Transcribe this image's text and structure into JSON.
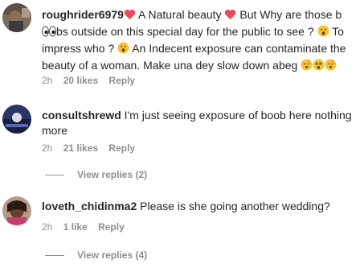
{
  "comments": [
    {
      "username": "roughrider6979",
      "lines": [
        {
          "parts": [
            {
              "t": "emoji",
              "icon": "red-heart-icon"
            },
            {
              "t": "text",
              "v": " A Natural beauty "
            },
            {
              "t": "emoji",
              "icon": "red-heart-icon"
            },
            {
              "t": "text",
              "v": " But Why are those b"
            }
          ]
        },
        {
          "parts": [
            {
              "t": "emoji",
              "icon": "eyes-icon"
            },
            {
              "t": "text",
              "v": "bs outside on this special day for the public to see ? "
            },
            {
              "t": "emoji",
              "icon": "surprised-face-icon"
            },
            {
              "t": "text",
              "v": " To"
            }
          ]
        },
        {
          "parts": [
            {
              "t": "text",
              "v": "impress who ? "
            },
            {
              "t": "emoji",
              "icon": "surprised-face-icon"
            },
            {
              "t": "text",
              "v": " An Indecent exposure can contaminate the"
            }
          ]
        },
        {
          "parts": [
            {
              "t": "text",
              "v": "beauty of a woman. Make una dey slow down abeg "
            },
            {
              "t": "emoji",
              "icon": "sleeping-face-icon"
            },
            {
              "t": "emoji",
              "icon": "dizzy-face-icon"
            },
            {
              "t": "emoji",
              "icon": "sleeping-face-icon"
            }
          ]
        }
      ],
      "time": "2h",
      "likes": "20 likes",
      "reply": "Reply"
    },
    {
      "username": "consultshrewd",
      "lines": [
        {
          "parts": [
            {
              "t": "text",
              "v": " I'm just seeing exposure of boob here nothing"
            }
          ]
        },
        {
          "parts": [
            {
              "t": "text",
              "v": "more"
            }
          ]
        }
      ],
      "time": "2h",
      "likes": "21 likes",
      "reply": "Reply",
      "view_replies": "View replies (2)"
    },
    {
      "username": "loveth_chidinma2",
      "lines": [
        {
          "parts": [
            {
              "t": "text",
              "v": " Please is she going another wedding?"
            }
          ]
        }
      ],
      "time": "2h",
      "likes": "1 like",
      "reply": "Reply",
      "view_replies": "View replies (4)"
    }
  ],
  "colors": {
    "text": "#262626",
    "meta": "#8e8e8e",
    "heart": "#ed4956"
  }
}
